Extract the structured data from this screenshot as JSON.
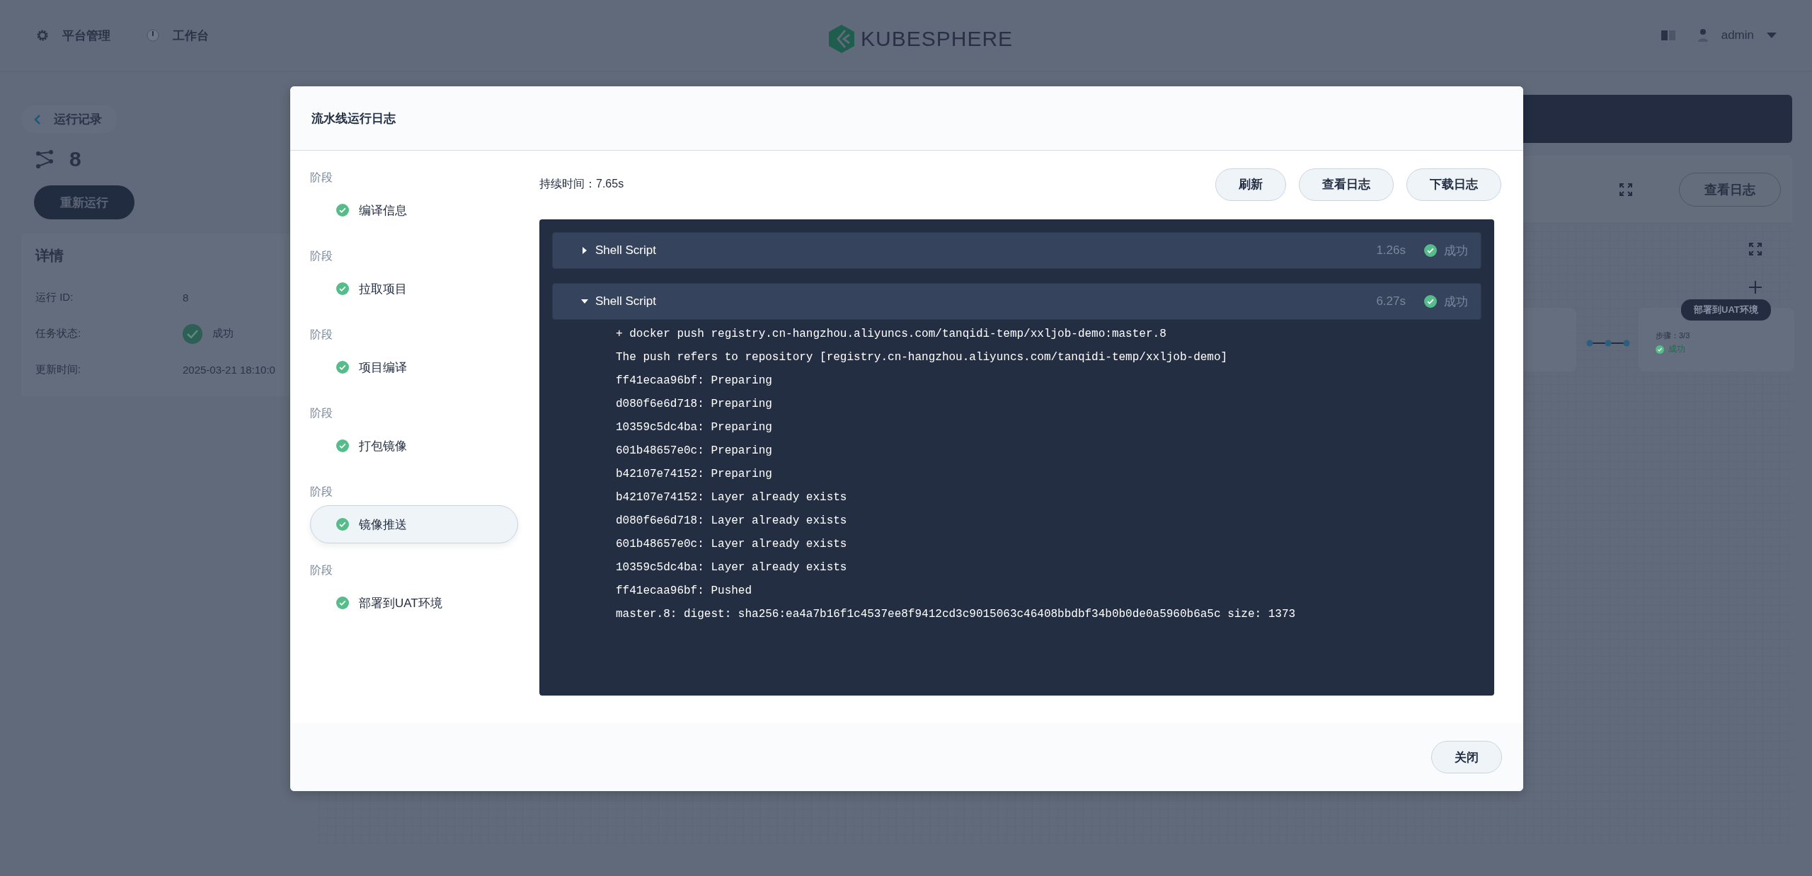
{
  "header": {
    "nav": [
      {
        "label": "平台管理",
        "kind": "gear"
      },
      {
        "label": "工作台",
        "kind": "gauge"
      }
    ],
    "logo": "KUBESPHERE",
    "user": "admin"
  },
  "run": {
    "back": "运行记录",
    "id": "8",
    "rerun": "重新运行",
    "details_title": "详情",
    "fields": [
      {
        "label": "运行 ID:",
        "value": "8",
        "kind": "text"
      },
      {
        "label": "任务状态:",
        "value": "成功",
        "kind": "status"
      },
      {
        "label": "更新时间:",
        "value": "2025-03-21 18:10:0",
        "kind": "text"
      }
    ]
  },
  "pipeline_panel": {
    "view_log": "查看日志",
    "node": {
      "tag": "部署到UAT环境",
      "steps": "步骤：3/3",
      "status": "成功"
    }
  },
  "dialog": {
    "title": "流水线运行日志",
    "stages": [
      {
        "heading": "阶段",
        "name": "编译信息",
        "selected": false
      },
      {
        "heading": "阶段",
        "name": "拉取项目",
        "selected": false
      },
      {
        "heading": "阶段",
        "name": "项目编译",
        "selected": false
      },
      {
        "heading": "阶段",
        "name": "打包镜像",
        "selected": false
      },
      {
        "heading": "阶段",
        "name": "镜像推送",
        "selected": true
      },
      {
        "heading": "阶段",
        "name": "部署到UAT环境",
        "selected": false
      }
    ],
    "duration": "持续时间：7.65s",
    "buttons": [
      "刷新",
      "查看日志",
      "下载日志"
    ],
    "steps": [
      {
        "name": "Shell Script",
        "expanded": false,
        "time": "1.26s",
        "status": "成功"
      },
      {
        "name": "Shell Script",
        "expanded": true,
        "time": "6.27s",
        "status": "成功",
        "lines": [
          "+ docker push registry.cn-hangzhou.aliyuncs.com/tanqidi-temp/xxljob-demo:master.8",
          "The push refers to repository [registry.cn-hangzhou.aliyuncs.com/tanqidi-temp/xxljob-demo]",
          "ff41ecaa96bf: Preparing",
          "d080f6e6d718: Preparing",
          "10359c5dc4ba: Preparing",
          "601b48657e0c: Preparing",
          "b42107e74152: Preparing",
          "b42107e74152: Layer already exists",
          "d080f6e6d718: Layer already exists",
          "601b48657e0c: Layer already exists",
          "10359c5dc4ba: Layer already exists",
          "ff41ecaa96bf: Pushed",
          "master.8: digest: sha256:ea4a7b16f1c4537ee8f9412cd3c9015063c46408bbdbf34b0b0de0a5960b6a5c size: 1373"
        ]
      }
    ],
    "close": "关闭"
  }
}
